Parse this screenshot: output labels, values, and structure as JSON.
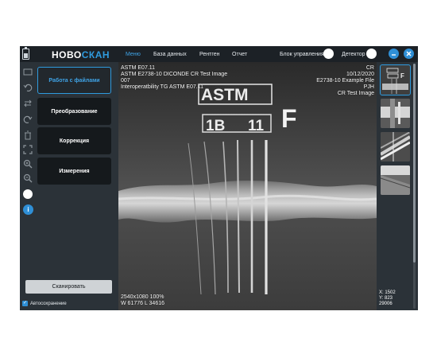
{
  "app": {
    "logo_left": "НОВО",
    "logo_right": "СКАН",
    "nav": [
      "Меню",
      "База данных",
      "Рентген",
      "Отчет"
    ],
    "control_unit_label": "Блок управления",
    "detector_label": "Детектор",
    "minimize_icon": "minimize-icon",
    "close_icon": "close-icon",
    "accent_color": "#2f9bde"
  },
  "sidebar": {
    "menu": [
      "Работа с файлами",
      "Преобразование",
      "Коррекция",
      "Измерения"
    ],
    "tools": [
      "folder-icon",
      "undo-icon",
      "flip-icon",
      "redo-icon",
      "trash-icon",
      "fullscreen-icon",
      "zoom-in-icon",
      "zoom-out-icon"
    ],
    "scan_label": "Сканировать",
    "autosave_label": "Автосохранение"
  },
  "overlay": {
    "top_left": [
      "ASTM E07.11",
      "ASTM E2738-10 DICONDE CR Test Image",
      "007",
      "Interoperatbility TG ASTM E07.11"
    ],
    "top_right": [
      "CR",
      "10/12/2020",
      "E2738-10 Example File",
      "PJH",
      "CR Test Image"
    ],
    "bottom_left": [
      "2540x1080 100%",
      "W 61776 L 34616"
    ],
    "image_text": [
      "ASTM",
      "1B",
      "11",
      "F"
    ]
  },
  "cursor": {
    "x_label": "X: 1502",
    "y_label": "Y: 823",
    "value_label": "29006"
  }
}
